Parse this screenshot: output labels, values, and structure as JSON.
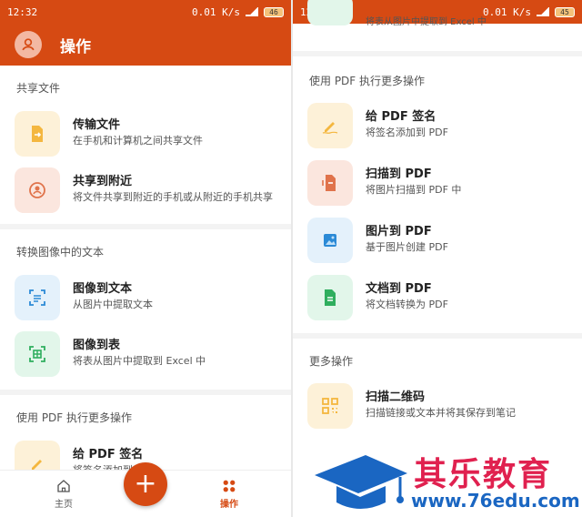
{
  "left": {
    "status": {
      "time": "12:32",
      "speed": "0.01",
      "speed_unit": "K/s",
      "battery": "46"
    },
    "appbar": {
      "title": "操作"
    },
    "sections": [
      {
        "title": "共享文件",
        "items": [
          {
            "title": "传输文件",
            "sub": "在手机和计算机之间共享文件",
            "icon": "transfer-file-icon"
          },
          {
            "title": "共享到附近",
            "sub": "将文件共享到附近的手机或从附近的手机共享",
            "icon": "share-nearby-icon"
          }
        ]
      },
      {
        "title": "转换图像中的文本",
        "items": [
          {
            "title": "图像到文本",
            "sub": "从图片中提取文本",
            "icon": "image-to-text-icon"
          },
          {
            "title": "图像到表",
            "sub": "将表从图片中提取到 Excel 中",
            "icon": "image-to-table-icon"
          }
        ]
      },
      {
        "title": "使用 PDF 执行更多操作",
        "items": [
          {
            "title": "给 PDF 签名",
            "sub": "将签名添加到 PDF",
            "icon": "sign-pdf-icon"
          }
        ]
      }
    ],
    "nav": {
      "home": "主页",
      "actions": "操作"
    }
  },
  "right": {
    "status": {
      "time": "12:32",
      "speed": "0.01",
      "speed_unit": "K/s",
      "battery": "45"
    },
    "top_partial_sub": "将表从图片中提取到 Excel 中",
    "sections": [
      {
        "title": "使用 PDF 执行更多操作",
        "items": [
          {
            "title": "给 PDF 签名",
            "sub": "将签名添加到 PDF",
            "icon": "sign-pdf-icon"
          },
          {
            "title": "扫描到 PDF",
            "sub": "将图片扫描到 PDF 中",
            "icon": "scan-to-pdf-icon"
          },
          {
            "title": "图片到 PDF",
            "sub": "基于图片创建 PDF",
            "icon": "image-to-pdf-icon"
          },
          {
            "title": "文档到 PDF",
            "sub": "将文档转换为 PDF",
            "icon": "doc-to-pdf-icon"
          }
        ]
      },
      {
        "title": "更多操作",
        "items": [
          {
            "title": "扫描二维码",
            "sub": "扫描链接或文本并将其保存到笔记",
            "icon": "qr-code-icon"
          }
        ]
      }
    ]
  },
  "watermark": {
    "brand": "其乐教育",
    "url": "www.76edu.com"
  },
  "colors": {
    "accent": "#d64a13",
    "watermark_red": "#e0214f",
    "watermark_blue": "#1a66c2"
  }
}
